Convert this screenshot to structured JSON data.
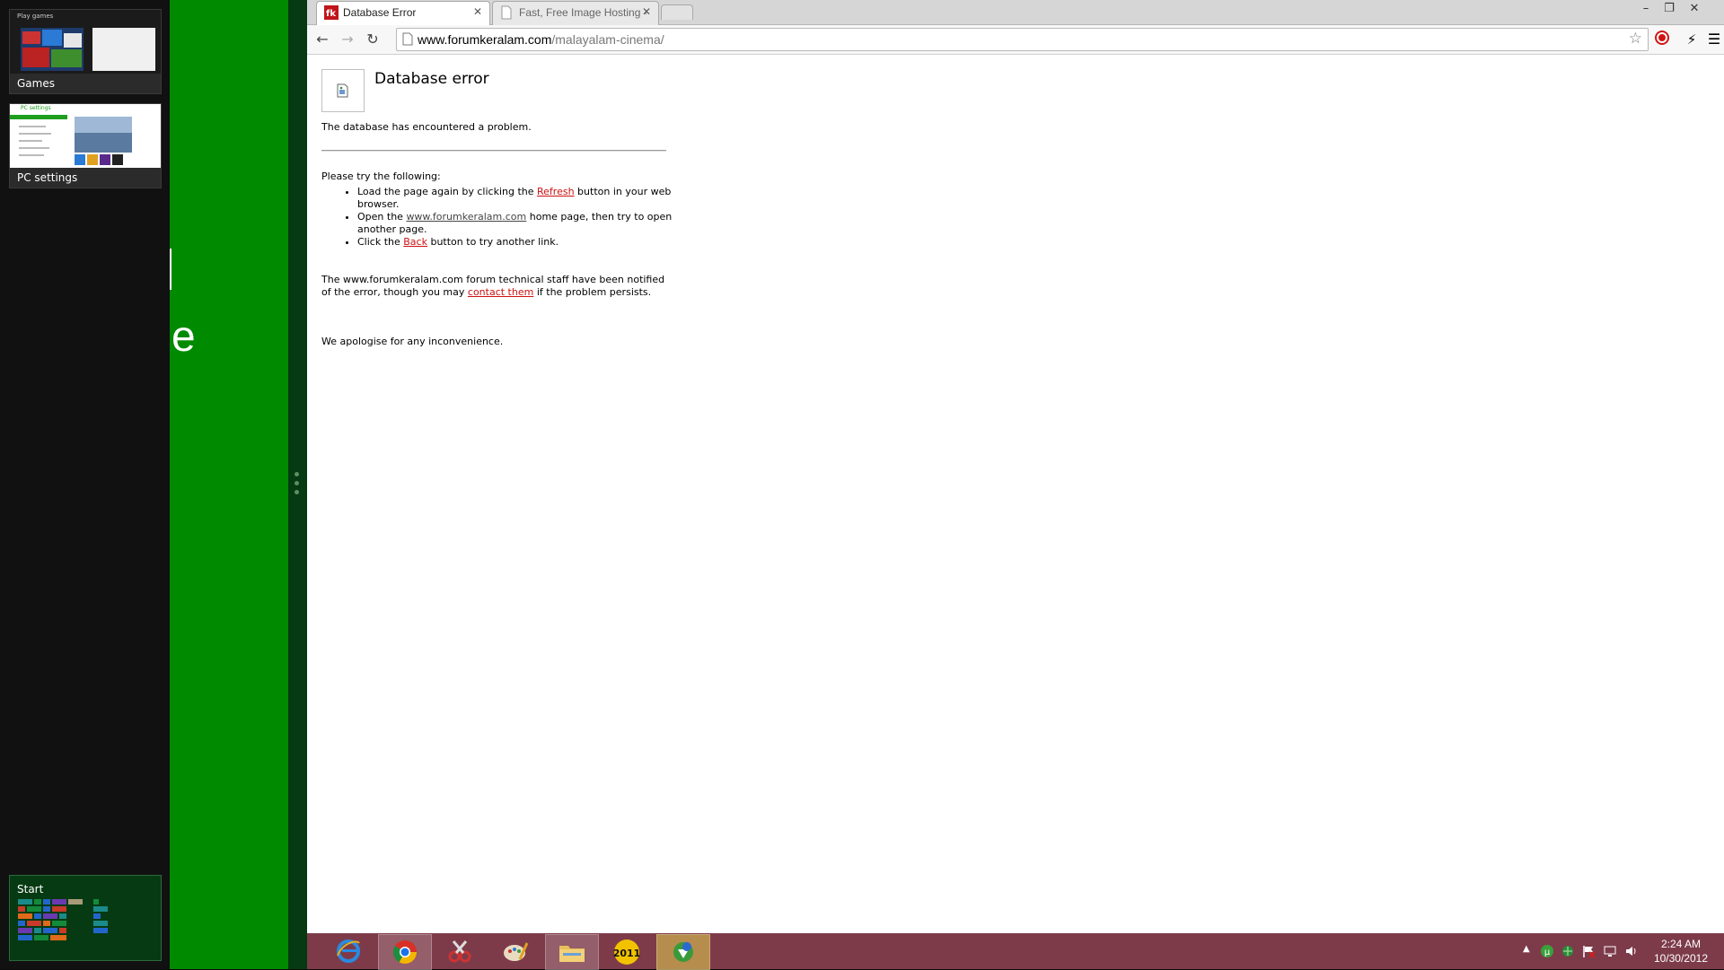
{
  "switcher": {
    "apps": [
      {
        "label": "Games",
        "preview_text": "Play games"
      },
      {
        "label": "PC settings",
        "preview_text": "PC settings"
      }
    ],
    "start_label": "Start"
  },
  "green_panel": {
    "partial_text": "e"
  },
  "browser": {
    "tabs": [
      {
        "title": "Database Error",
        "favicon_text": "fk",
        "active": true
      },
      {
        "title": "Fast, Free Image Hosting -",
        "active": false
      }
    ],
    "url_host": "www.forumkeralam.com",
    "url_path": "/malayalam-cinema/"
  },
  "page": {
    "title": "Database error",
    "message": "The database has encountered a problem.",
    "try_heading": "Please try the following:",
    "step1_pre": "Load the page again by clicking the ",
    "step1_link": "Refresh",
    "step1_post": " button in your web browser.",
    "step2_pre": "Open the ",
    "step2_link": "www.forumkeralam.com",
    "step2_post": " home page, then try to open another page.",
    "step3_pre": "Click the ",
    "step3_link": "Back",
    "step3_post": " button to try another link.",
    "notified_pre": "The www.forumkeralam.com forum technical staff have been notified of the error, though you may ",
    "notified_link": "contact them",
    "notified_post": " if the problem persists.",
    "apology": "We apologise for any inconvenience."
  },
  "taskbar": {
    "year_badge": "2011",
    "time": "2:24 AM",
    "date": "10/30/2012"
  },
  "colors": {
    "start_green": "#008a00",
    "taskbar": "#7d3b4a",
    "link_red": "#cc1111"
  }
}
